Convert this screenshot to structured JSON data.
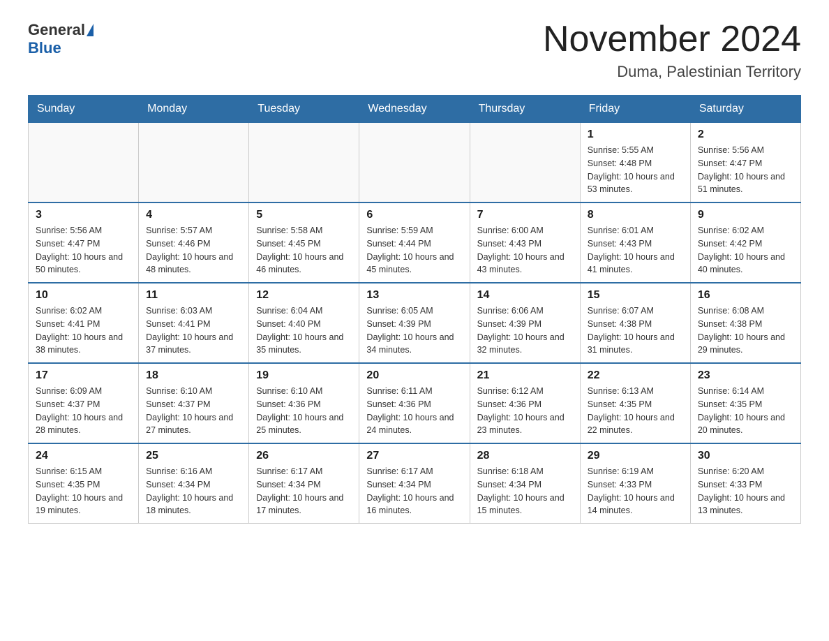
{
  "header": {
    "logo_general": "General",
    "logo_blue": "Blue",
    "month_title": "November 2024",
    "location": "Duma, Palestinian Territory"
  },
  "days_of_week": [
    "Sunday",
    "Monday",
    "Tuesday",
    "Wednesday",
    "Thursday",
    "Friday",
    "Saturday"
  ],
  "weeks": [
    {
      "days": [
        {
          "num": "",
          "info": ""
        },
        {
          "num": "",
          "info": ""
        },
        {
          "num": "",
          "info": ""
        },
        {
          "num": "",
          "info": ""
        },
        {
          "num": "",
          "info": ""
        },
        {
          "num": "1",
          "info": "Sunrise: 5:55 AM\nSunset: 4:48 PM\nDaylight: 10 hours and 53 minutes."
        },
        {
          "num": "2",
          "info": "Sunrise: 5:56 AM\nSunset: 4:47 PM\nDaylight: 10 hours and 51 minutes."
        }
      ]
    },
    {
      "days": [
        {
          "num": "3",
          "info": "Sunrise: 5:56 AM\nSunset: 4:47 PM\nDaylight: 10 hours and 50 minutes."
        },
        {
          "num": "4",
          "info": "Sunrise: 5:57 AM\nSunset: 4:46 PM\nDaylight: 10 hours and 48 minutes."
        },
        {
          "num": "5",
          "info": "Sunrise: 5:58 AM\nSunset: 4:45 PM\nDaylight: 10 hours and 46 minutes."
        },
        {
          "num": "6",
          "info": "Sunrise: 5:59 AM\nSunset: 4:44 PM\nDaylight: 10 hours and 45 minutes."
        },
        {
          "num": "7",
          "info": "Sunrise: 6:00 AM\nSunset: 4:43 PM\nDaylight: 10 hours and 43 minutes."
        },
        {
          "num": "8",
          "info": "Sunrise: 6:01 AM\nSunset: 4:43 PM\nDaylight: 10 hours and 41 minutes."
        },
        {
          "num": "9",
          "info": "Sunrise: 6:02 AM\nSunset: 4:42 PM\nDaylight: 10 hours and 40 minutes."
        }
      ]
    },
    {
      "days": [
        {
          "num": "10",
          "info": "Sunrise: 6:02 AM\nSunset: 4:41 PM\nDaylight: 10 hours and 38 minutes."
        },
        {
          "num": "11",
          "info": "Sunrise: 6:03 AM\nSunset: 4:41 PM\nDaylight: 10 hours and 37 minutes."
        },
        {
          "num": "12",
          "info": "Sunrise: 6:04 AM\nSunset: 4:40 PM\nDaylight: 10 hours and 35 minutes."
        },
        {
          "num": "13",
          "info": "Sunrise: 6:05 AM\nSunset: 4:39 PM\nDaylight: 10 hours and 34 minutes."
        },
        {
          "num": "14",
          "info": "Sunrise: 6:06 AM\nSunset: 4:39 PM\nDaylight: 10 hours and 32 minutes."
        },
        {
          "num": "15",
          "info": "Sunrise: 6:07 AM\nSunset: 4:38 PM\nDaylight: 10 hours and 31 minutes."
        },
        {
          "num": "16",
          "info": "Sunrise: 6:08 AM\nSunset: 4:38 PM\nDaylight: 10 hours and 29 minutes."
        }
      ]
    },
    {
      "days": [
        {
          "num": "17",
          "info": "Sunrise: 6:09 AM\nSunset: 4:37 PM\nDaylight: 10 hours and 28 minutes."
        },
        {
          "num": "18",
          "info": "Sunrise: 6:10 AM\nSunset: 4:37 PM\nDaylight: 10 hours and 27 minutes."
        },
        {
          "num": "19",
          "info": "Sunrise: 6:10 AM\nSunset: 4:36 PM\nDaylight: 10 hours and 25 minutes."
        },
        {
          "num": "20",
          "info": "Sunrise: 6:11 AM\nSunset: 4:36 PM\nDaylight: 10 hours and 24 minutes."
        },
        {
          "num": "21",
          "info": "Sunrise: 6:12 AM\nSunset: 4:36 PM\nDaylight: 10 hours and 23 minutes."
        },
        {
          "num": "22",
          "info": "Sunrise: 6:13 AM\nSunset: 4:35 PM\nDaylight: 10 hours and 22 minutes."
        },
        {
          "num": "23",
          "info": "Sunrise: 6:14 AM\nSunset: 4:35 PM\nDaylight: 10 hours and 20 minutes."
        }
      ]
    },
    {
      "days": [
        {
          "num": "24",
          "info": "Sunrise: 6:15 AM\nSunset: 4:35 PM\nDaylight: 10 hours and 19 minutes."
        },
        {
          "num": "25",
          "info": "Sunrise: 6:16 AM\nSunset: 4:34 PM\nDaylight: 10 hours and 18 minutes."
        },
        {
          "num": "26",
          "info": "Sunrise: 6:17 AM\nSunset: 4:34 PM\nDaylight: 10 hours and 17 minutes."
        },
        {
          "num": "27",
          "info": "Sunrise: 6:17 AM\nSunset: 4:34 PM\nDaylight: 10 hours and 16 minutes."
        },
        {
          "num": "28",
          "info": "Sunrise: 6:18 AM\nSunset: 4:34 PM\nDaylight: 10 hours and 15 minutes."
        },
        {
          "num": "29",
          "info": "Sunrise: 6:19 AM\nSunset: 4:33 PM\nDaylight: 10 hours and 14 minutes."
        },
        {
          "num": "30",
          "info": "Sunrise: 6:20 AM\nSunset: 4:33 PM\nDaylight: 10 hours and 13 minutes."
        }
      ]
    }
  ]
}
